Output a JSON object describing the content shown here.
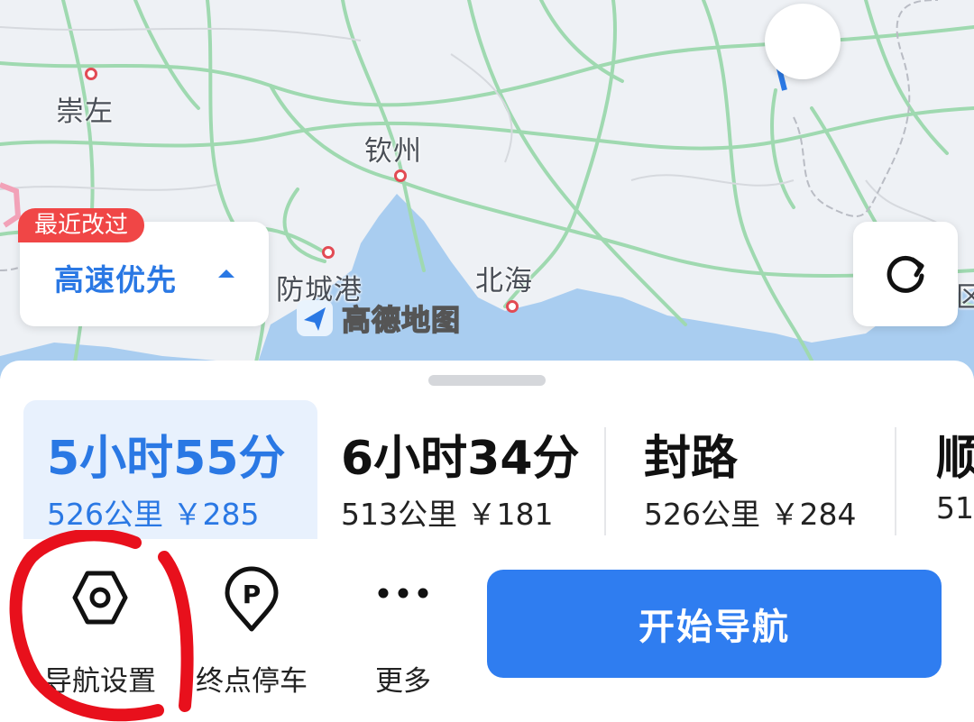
{
  "map": {
    "cities": [
      {
        "name": "崇左"
      },
      {
        "name": "钦州"
      },
      {
        "name": "防城港"
      },
      {
        "name": "北海"
      }
    ],
    "right_edge_fragment": "区",
    "logo_text": "高德地图",
    "route_preference": {
      "badge": "最近改过",
      "label": "高速优先"
    },
    "refresh_icon": "refresh-icon"
  },
  "routes": [
    {
      "time": "5小时55分",
      "meta": "526公里 ￥285",
      "selected": true
    },
    {
      "time": "6小时34分",
      "meta": "513公里 ￥181",
      "selected": false
    },
    {
      "time": "封路",
      "meta": "526公里 ￥284",
      "selected": false
    },
    {
      "time": "顺",
      "meta": "51",
      "selected": false
    }
  ],
  "actions": [
    {
      "label": "导航设置",
      "icon": "settings-hexagon-icon"
    },
    {
      "label": "终点停车",
      "icon": "parking-pin-icon"
    },
    {
      "label": "更多",
      "icon": "more-dots-icon"
    }
  ],
  "start_button": "开始导航",
  "colors": {
    "accent": "#2f7df0",
    "selected_text": "#2a78e4",
    "badge": "#f04646",
    "annotation": "#e8101c"
  }
}
